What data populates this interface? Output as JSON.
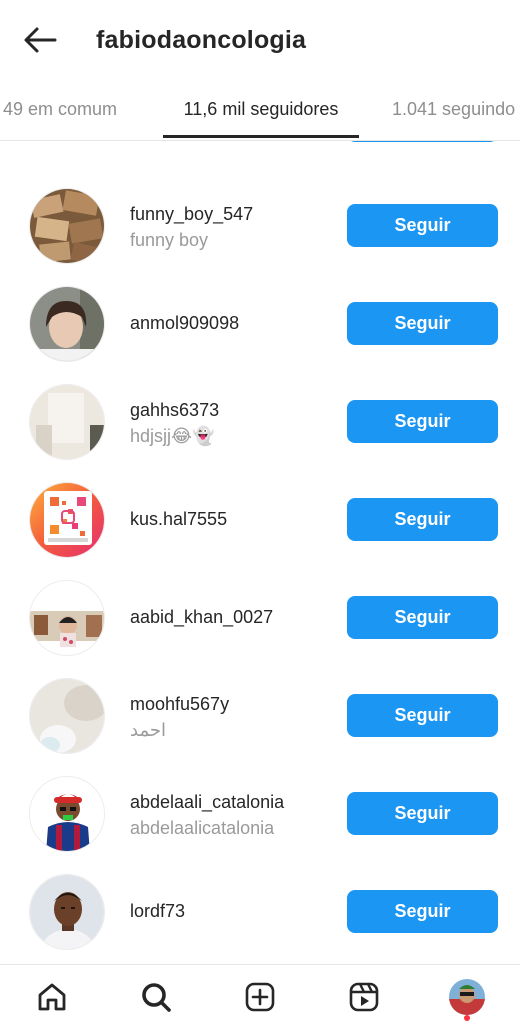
{
  "header": {
    "title": "fabiodaoncologia",
    "back_icon": "arrow-left-icon"
  },
  "tabs": [
    {
      "label": "49 em comum",
      "active": false
    },
    {
      "label": "11,6 mil seguidores",
      "active": true
    },
    {
      "label": "1.041 seguindo",
      "active": false
    }
  ],
  "followers": [
    {
      "username": "funny_boy_547",
      "fullname": "funny boy",
      "button": "Seguir",
      "avatar": "money-stacks-photo"
    },
    {
      "username": "anmol909098",
      "fullname": "",
      "button": "Seguir",
      "avatar": "woman-portrait-photo"
    },
    {
      "username": "gahhs6373",
      "fullname": "hdjsjj😂👻",
      "button": "Seguir",
      "avatar": "room-wall-photo"
    },
    {
      "username": "kus.hal7555",
      "fullname": "",
      "button": "Seguir",
      "avatar": "instagram-qr-code"
    },
    {
      "username": "aabid_khan_0027",
      "fullname": "",
      "button": "Seguir",
      "avatar": "child-photo"
    },
    {
      "username": "moohfu567y",
      "fullname": "احمد",
      "button": "Seguir",
      "avatar": "blurred-photo"
    },
    {
      "username": "abdelaali_catalonia",
      "fullname": "abdelaalicatalonia",
      "button": "Seguir",
      "avatar": "cartoon-football-player"
    },
    {
      "username": "lordf73",
      "fullname": "",
      "button": "Seguir",
      "avatar": "football-player-photo"
    }
  ],
  "colors": {
    "accent": "#1c96f3",
    "text": "#262626",
    "secondary_text": "#9a9a9a",
    "notification_dot": "#ff3040"
  },
  "bottom_nav": [
    "home-icon",
    "search-icon",
    "create-post-icon",
    "reels-icon",
    "profile-avatar"
  ]
}
